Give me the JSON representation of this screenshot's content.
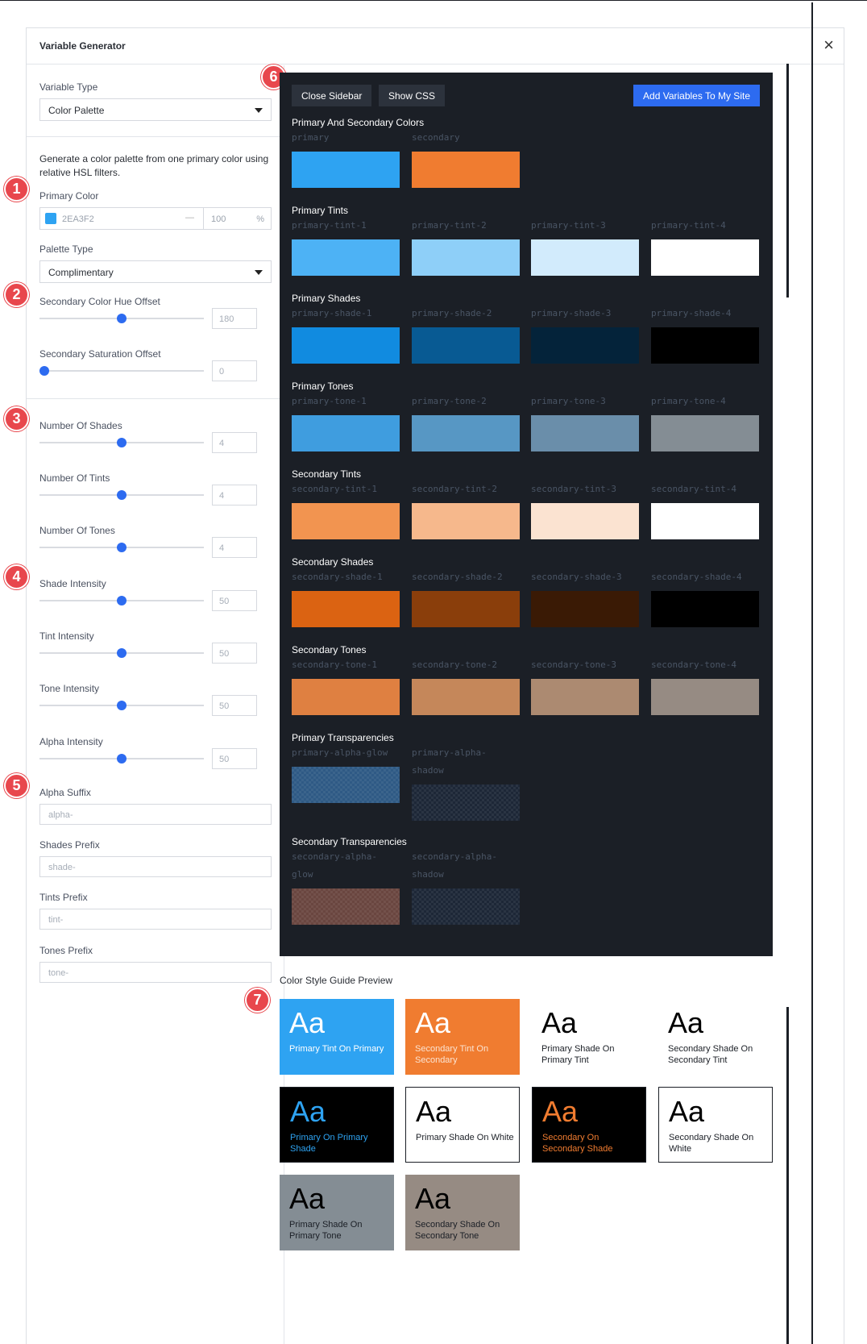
{
  "dialog": {
    "title": "Variable Generator",
    "close": "×"
  },
  "sidebar": {
    "variable_type": {
      "label": "Variable Type",
      "value": "Color Palette"
    },
    "description": "Generate a color palette from one primary color using relative HSL filters.",
    "primary_color": {
      "label": "Primary Color",
      "hex": "2EA3F2",
      "opacity": "100",
      "unit": "%",
      "dash": "—",
      "swatch": "#2EA3F2"
    },
    "palette_type": {
      "label": "Palette Type",
      "value": "Complimentary"
    },
    "sliders": [
      {
        "key": "hue",
        "label": "Secondary Color Hue Offset",
        "value": "180",
        "fraction": 0.5
      },
      {
        "key": "sat",
        "label": "Secondary Saturation Offset",
        "value": "0",
        "fraction": 0.0
      },
      {
        "key": "shades",
        "label": "Number Of Shades",
        "value": "4",
        "fraction": 0.5
      },
      {
        "key": "tints",
        "label": "Number Of Tints",
        "value": "4",
        "fraction": 0.5
      },
      {
        "key": "tones",
        "label": "Number Of Tones",
        "value": "4",
        "fraction": 0.5
      },
      {
        "key": "shade_int",
        "label": "Shade Intensity",
        "value": "50",
        "fraction": 0.5
      },
      {
        "key": "tint_int",
        "label": "Tint Intensity",
        "value": "50",
        "fraction": 0.5
      },
      {
        "key": "tone_int",
        "label": "Tone Intensity",
        "value": "50",
        "fraction": 0.5
      },
      {
        "key": "alpha_int",
        "label": "Alpha Intensity",
        "value": "50",
        "fraction": 0.5
      }
    ],
    "alpha_suffix": {
      "label": "Alpha Suffix",
      "placeholder": "alpha-"
    },
    "shades_prefix": {
      "label": "Shades Prefix",
      "placeholder": "shade-"
    },
    "tints_prefix": {
      "label": "Tints Prefix",
      "placeholder": "tint-"
    },
    "tones_prefix": {
      "label": "Tones Prefix",
      "placeholder": "tone-"
    }
  },
  "badges": [
    "1",
    "2",
    "3",
    "4",
    "5",
    "6",
    "7"
  ],
  "toolbar": {
    "close_sidebar": "Close Sidebar",
    "show_css": "Show CSS",
    "add_variables": "Add Variables To My Site"
  },
  "groups": [
    {
      "title": "Primary And Secondary Colors",
      "items": [
        {
          "name": "primary",
          "color": "#2EA3F2"
        },
        {
          "name": "secondary",
          "color": "#F07C30"
        }
      ]
    },
    {
      "title": "Primary Tints",
      "items": [
        {
          "name": "primary-tint-1",
          "color": "#4DB2F5"
        },
        {
          "name": "primary-tint-2",
          "color": "#8ECFF8"
        },
        {
          "name": "primary-tint-3",
          "color": "#D2EBFC"
        },
        {
          "name": "primary-tint-4",
          "color": "#FFFFFF"
        }
      ]
    },
    {
      "title": "Primary Shades",
      "items": [
        {
          "name": "primary-shade-1",
          "color": "#118BE0"
        },
        {
          "name": "primary-shade-2",
          "color": "#085A93"
        },
        {
          "name": "primary-shade-3",
          "color": "#04233A"
        },
        {
          "name": "primary-shade-4",
          "color": "#000000"
        }
      ]
    },
    {
      "title": "Primary Tones",
      "items": [
        {
          "name": "primary-tone-1",
          "color": "#3F9DDF"
        },
        {
          "name": "primary-tone-2",
          "color": "#5797C4"
        },
        {
          "name": "primary-tone-3",
          "color": "#6A8EAA"
        },
        {
          "name": "primary-tone-4",
          "color": "#848D94"
        }
      ]
    },
    {
      "title": "Secondary Tints",
      "items": [
        {
          "name": "secondary-tint-1",
          "color": "#F29450"
        },
        {
          "name": "secondary-tint-2",
          "color": "#F6B88C"
        },
        {
          "name": "secondary-tint-3",
          "color": "#FBE3D1"
        },
        {
          "name": "secondary-tint-4",
          "color": "#FFFFFF"
        }
      ]
    },
    {
      "title": "Secondary Shades",
      "items": [
        {
          "name": "secondary-shade-1",
          "color": "#DB6312"
        },
        {
          "name": "secondary-shade-2",
          "color": "#8A3E0B"
        },
        {
          "name": "secondary-shade-3",
          "color": "#3A1A05"
        },
        {
          "name": "secondary-shade-4",
          "color": "#000000"
        }
      ]
    },
    {
      "title": "Secondary Tones",
      "items": [
        {
          "name": "secondary-tone-1",
          "color": "#DF8041"
        },
        {
          "name": "secondary-tone-2",
          "color": "#C5875A"
        },
        {
          "name": "secondary-tone-3",
          "color": "#AC8A71"
        },
        {
          "name": "secondary-tone-4",
          "color": "#968B83"
        }
      ]
    }
  ],
  "transparencies": [
    {
      "title": "Primary Transparencies",
      "items": [
        {
          "name": "primary-alpha-glow",
          "color": "#2F5A85"
        },
        {
          "name": "primary-alpha-shadow",
          "color": "#1D2737"
        }
      ]
    },
    {
      "title": "Secondary Transparencies",
      "items": [
        {
          "name": "secondary-alpha-glow",
          "color": "#6A4640"
        },
        {
          "name": "secondary-alpha-shadow",
          "color": "#1D2737"
        }
      ]
    }
  ],
  "style_guide": {
    "title": "Color Style Guide Preview",
    "aa": "Aa",
    "cards": [
      {
        "label": "Primary Tint On Primary",
        "bg": "#2EA3F2",
        "fg": "#FFFFFF",
        "cap": "#FFFFFF",
        "border": false
      },
      {
        "label": "Secondary Tint On Secondary",
        "bg": "#F07C30",
        "fg": "#FFFFFF",
        "cap": "#FBE3D1",
        "border": false
      },
      {
        "label": "Primary Shade On Primary Tint",
        "bg": "#FFFFFF",
        "fg": "#000000",
        "cap": "#1B1F26",
        "border": false
      },
      {
        "label": "Secondary Shade On Secondary Tint",
        "bg": "#FFFFFF",
        "fg": "#000000",
        "cap": "#1B1F26",
        "border": false
      },
      {
        "label": "Primary On Primary Shade",
        "bg": "#000000",
        "fg": "#2EA3F2",
        "cap": "#2EA3F2",
        "border": true
      },
      {
        "label": "Primary Shade On White",
        "bg": "#FFFFFF",
        "fg": "#000000",
        "cap": "#1B1F26",
        "border": true
      },
      {
        "label": "Secondary On Secondary Shade",
        "bg": "#000000",
        "fg": "#F07C30",
        "cap": "#F07C30",
        "border": true
      },
      {
        "label": "Secondary Shade On White",
        "bg": "#FFFFFF",
        "fg": "#000000",
        "cap": "#1B1F26",
        "border": true
      },
      {
        "label": "Primary Shade On Primary Tone",
        "bg": "#848D94",
        "fg": "#000000",
        "cap": "#1B1F26",
        "border": false
      },
      {
        "label": "Secondary Shade On Secondary Tone",
        "bg": "#968B83",
        "fg": "#000000",
        "cap": "#1B1F26",
        "border": false
      }
    ]
  }
}
